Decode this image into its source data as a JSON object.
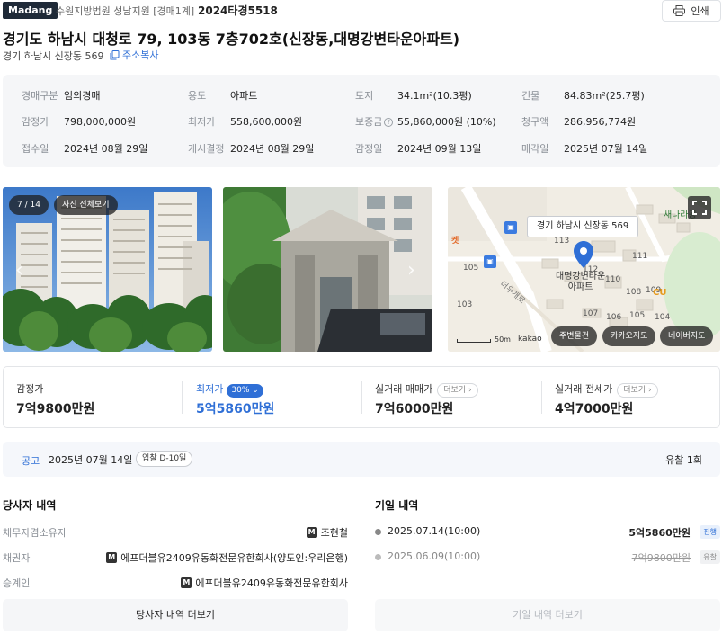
{
  "header": {
    "logo": "Madang",
    "court": "수원지방법원 성남지원 [경매1계]",
    "case_no": "2024타경5518",
    "print_label": "인쇄"
  },
  "property": {
    "title": "경기도 하남시 대청로 79, 103동 7층702호(신장동,대명강변타운아파트)",
    "jibun": "경기 하남시 신장동 569",
    "copy_label": "주소복사"
  },
  "info": [
    {
      "label": "경매구분",
      "value": "임의경매"
    },
    {
      "label": "용도",
      "value": "아파트"
    },
    {
      "label": "토지",
      "value": "34.1m²(10.3평)"
    },
    {
      "label": "건물",
      "value": "84.83m²(25.7평)"
    },
    {
      "label": "감정가",
      "value": "798,000,000원"
    },
    {
      "label": "최저가",
      "value": "558,600,000원"
    },
    {
      "label": "보증금",
      "value": "55,860,000원 (10%)"
    },
    {
      "label": "청구액",
      "value": "286,956,774원"
    },
    {
      "label": "접수일",
      "value": "2024년 08월 29일"
    },
    {
      "label": "개시결정",
      "value": "2024년 08월 29일"
    },
    {
      "label": "감정일",
      "value": "2024년 09월 13일"
    },
    {
      "label": "매각일",
      "value": "2025년 07월 14일"
    }
  ],
  "gallery": {
    "counter": "7 / 14",
    "view_all": "사진 전체보기"
  },
  "map": {
    "tag": "경기 하남시 신장동 569",
    "complex_name": "대명강변타운\n아파트",
    "place_park": "새나라공",
    "place_road": "더우개로",
    "place_cu": "CU",
    "scale": "50m",
    "brand": "kakao",
    "btn_nearby": "주변물건",
    "btn_kakao": "카카오지도",
    "btn_naver": "네이버지도",
    "numbers": [
      "113",
      "111",
      "110",
      "112",
      "105",
      "103",
      "108",
      "109",
      "107",
      "106",
      "105",
      "104"
    ]
  },
  "prices": {
    "appraisal_label": "감정가",
    "appraisal_value": "7억9800만원",
    "min_label": "최저가",
    "min_badge": "30%",
    "min_value": "5억5860만원",
    "trade_label": "실거래 매매가",
    "trade_value": "7억6000만원",
    "jeonse_label": "실거래 전세가",
    "jeonse_value": "4억7000만원",
    "more_label": "더보기"
  },
  "notice": {
    "label": "공고",
    "date": "2025년 07월 14일",
    "dday": "입찰 D-10일",
    "result": "유찰 1회"
  },
  "parties": {
    "title": "당사자 내역",
    "rows": [
      {
        "label": "채무자겸소유자",
        "value": "조현철"
      },
      {
        "label": "채권자",
        "value": "에프더블유2409유동화전문유한회사(양도인:우리은행)"
      },
      {
        "label": "승계인",
        "value": "에프더블유2409유동화전문유한회사"
      }
    ],
    "more_button": "당사자 내역 더보기",
    "mark": "M"
  },
  "history": {
    "title": "기일 내역",
    "rows": [
      {
        "date": "2025.07.14(10:00)",
        "price": "5억5860만원",
        "status": "진행"
      },
      {
        "date": "2025.06.09(10:00)",
        "price": "7억9800만원",
        "status": "유찰"
      }
    ],
    "more_button": "기일 내역 더보기"
  }
}
